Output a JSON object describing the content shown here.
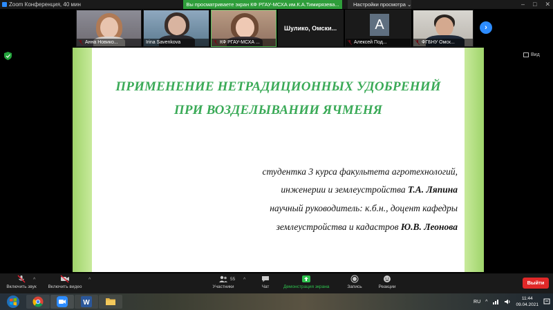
{
  "window": {
    "title": "Zoom Конференция, 40 мин",
    "share_banner": "Вы просматриваете экран КФ РГАУ-МСХА им.К.А.Тимирязева...",
    "view_options": "Настройки просмотра"
  },
  "participants": [
    {
      "name": "Анна Новико...",
      "muted": true
    },
    {
      "name": "Irina Savenkova",
      "muted": false
    },
    {
      "name": "КФ РГАУ-МСХА ...",
      "muted": true,
      "active": true
    },
    {
      "name": "Шулико,  Омски...",
      "muted": false
    },
    {
      "name": "Алексей Под...",
      "muted": true,
      "avatar_letter": "A"
    },
    {
      "name": "ФГБНУ Омск...",
      "muted": true
    }
  ],
  "view_button": "Вид",
  "slide": {
    "title_line1": "ПРИМЕНЕНИЕ НЕТРАДИЦИОННЫХ УДОБРЕНИЙ",
    "title_line2": "ПРИ ВОЗДЕЛЫВАНИИ ЯЧМЕНЯ",
    "line1": "студентка 3 курса факультета агротехнологий,",
    "line2_text": "инженерии и землеустройства ",
    "line2_bold": "Т.А. Ляпина",
    "line3": "научный руководитель: к.б.н., доцент кафедры",
    "line4_text": "землеустройства и кадастров ",
    "line4_bold": "Ю.В. Леонова",
    "colors": {
      "title": "#3aaa57",
      "band": "#9fd46a"
    }
  },
  "toolbar": {
    "audio": "Включить звук",
    "video": "Включить видео",
    "participants": "Участники",
    "participants_count": "55",
    "chat": "Чат",
    "share": "Демонстрация экрана",
    "record": "Запись",
    "reactions": "Реакции",
    "leave": "Выйти"
  },
  "taskbar": {
    "language": "RU",
    "time": "11:44",
    "date": "09.04.2021"
  }
}
